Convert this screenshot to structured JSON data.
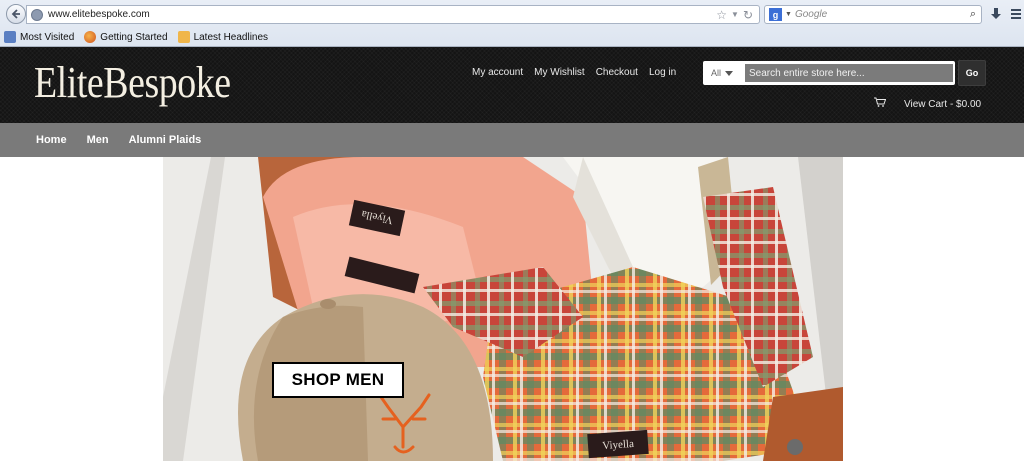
{
  "browser": {
    "url": "www.elitebespoke.com",
    "search_engine": "Google",
    "bookmarks": [
      {
        "label": "Most Visited",
        "icon": "bookmark-icon"
      },
      {
        "label": "Getting Started",
        "icon": "firefox-icon"
      },
      {
        "label": "Latest Headlines",
        "icon": "rss-icon"
      }
    ]
  },
  "site": {
    "logo": "EliteBespoke",
    "account_links": [
      "My account",
      "My Wishlist",
      "Checkout",
      "Log in"
    ],
    "search": {
      "category": "All",
      "placeholder": "Search entire store here...",
      "go_label": "Go"
    },
    "cart_label": "View Cart - $0.00"
  },
  "nav": {
    "items": [
      "Home",
      "Men",
      "Alumni Plaids"
    ]
  },
  "hero": {
    "cta_label": "SHOP MEN",
    "labels": [
      "Viyella",
      "Viyella",
      "Viyella"
    ]
  },
  "colors": {
    "header_bg": "#141414",
    "nav_bg": "#7a7a7a",
    "logo": "#f4efe2"
  }
}
